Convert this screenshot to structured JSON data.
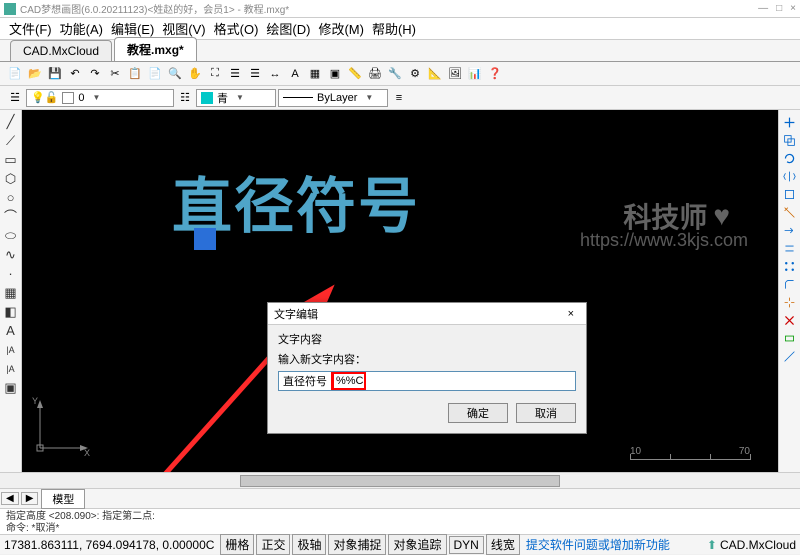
{
  "window": {
    "title": "CAD梦想画图(6.0.20211123)<姓赵的好，会员1> - 教程.mxg*",
    "min": "—",
    "max": "□",
    "close": "×"
  },
  "menu": {
    "items": [
      "文件(F)",
      "功能(A)",
      "编辑(E)",
      "视图(V)",
      "格式(O)",
      "绘图(D)",
      "修改(M)",
      "帮助(H)"
    ]
  },
  "tabs": {
    "items": [
      {
        "label": "CAD.MxCloud",
        "active": false
      },
      {
        "label": "教程.mxg*",
        "active": true
      }
    ]
  },
  "toolbar2": {
    "layer": {
      "value": "0",
      "swatch": "#ffffff"
    },
    "color": {
      "value": "青",
      "swatch": "#00c8c8"
    },
    "linetype": {
      "value": "ByLayer"
    }
  },
  "canvas": {
    "text": "直径符号",
    "watermark1": "科技师",
    "watermark2": "https://www.3kjs.com",
    "scale_labels": {
      "a": "10",
      "b": "70"
    }
  },
  "dialog": {
    "title": "文字编辑",
    "group": "文字内容",
    "label": "输入新文字内容：",
    "prefix": "直径符号",
    "redbox_value": "%%C",
    "ok": "确定",
    "cancel": "取消"
  },
  "model_tabs": {
    "prev": "◀",
    "next": "▶",
    "model": "模型"
  },
  "cmdline": {
    "line1": "指定高度 <208.090>:  指定第二点:",
    "line2": "命令: *取消*"
  },
  "status": {
    "coords": "17381.863111, 7694.094178, 0.00000C",
    "buttons": [
      "栅格",
      "正交",
      "极轴",
      "对象捕捉",
      "对象追踪",
      "DYN",
      "线宽"
    ],
    "link": "提交软件问题或增加新功能",
    "cloud": "CAD.MxCloud"
  }
}
